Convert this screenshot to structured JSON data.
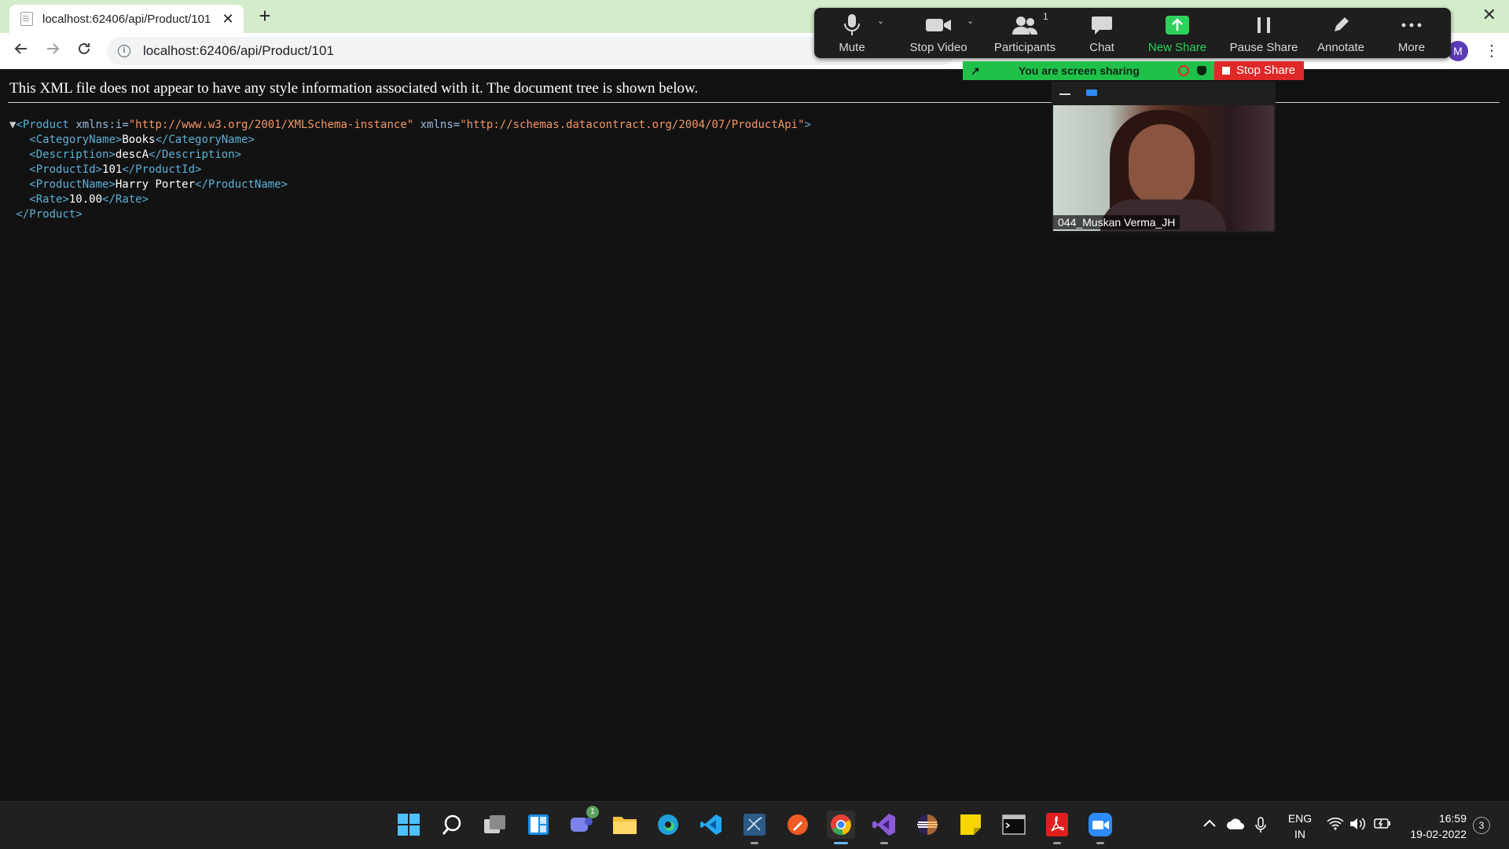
{
  "browser": {
    "tab_title": "localhost:62406/api/Product/101",
    "tab_close": "✕",
    "new_tab": "+",
    "window_close": "✕",
    "url": "localhost:62406/api/Product/101",
    "profile_initial": "M"
  },
  "page": {
    "banner": "This XML file does not appear to have any style information associated with it. The document tree is shown below.",
    "xml": {
      "root_open": "<Product",
      "root_attr1_name": "xmlns:i=",
      "root_attr1_value": "\"http://www.w3.org/2001/XMLSchema-instance\"",
      "root_attr2_name": "xmlns=",
      "root_attr2_value": "\"http://schemas.datacontract.org/2004/07/ProductApi\"",
      "root_close": "</Product>",
      "elements": [
        {
          "open": "<CategoryName>",
          "value": "Books",
          "close": "</CategoryName>"
        },
        {
          "open": "<Description>",
          "value": "descA",
          "close": "</Description>"
        },
        {
          "open": "<ProductId>",
          "value": "101",
          "close": "</ProductId>"
        },
        {
          "open": "<ProductName>",
          "value": "Harry Porter",
          "close": "</ProductName>"
        },
        {
          "open": "<Rate>",
          "value": "10.00",
          "close": "</Rate>"
        }
      ]
    }
  },
  "zoom": {
    "buttons": [
      {
        "label": "Mute",
        "icon": "microphone-icon"
      },
      {
        "label": "Stop Video",
        "icon": "camera-icon"
      },
      {
        "label": "Participants",
        "icon": "participants-icon",
        "count": "1"
      },
      {
        "label": "Chat",
        "icon": "chat-icon"
      },
      {
        "label": "New Share",
        "icon": "share-arrow-icon"
      },
      {
        "label": "Pause Share",
        "icon": "pause-icon"
      },
      {
        "label": "Annotate",
        "icon": "pencil-icon"
      },
      {
        "label": "More",
        "icon": "ellipsis-icon"
      }
    ],
    "sharing_text": "You are screen sharing",
    "stop_share": "Stop Share",
    "participant_name": "044_Muskan Verma_JH",
    "accent_green": "#2dd25a",
    "stop_red": "#e02828"
  },
  "taskbar": {
    "apps": [
      "windows-start-icon",
      "search-icon",
      "task-view-icon",
      "widgets-icon",
      "teams-chat-icon",
      "file-explorer-icon",
      "edge-icon",
      "vscode-icon",
      "sql-server-icon",
      "postman-icon",
      "chrome-icon",
      "visual-studio-icon",
      "eclipse-icon",
      "sticky-notes-icon",
      "terminal-icon",
      "acrobat-icon",
      "zoom-icon"
    ],
    "chat_badge": "1",
    "lang_line1": "ENG",
    "lang_line2": "IN",
    "time": "16:59",
    "date": "19-02-2022",
    "notification_count": "3"
  }
}
